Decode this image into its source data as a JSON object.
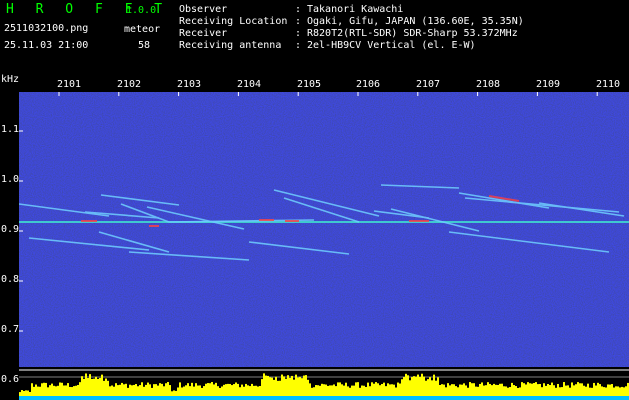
{
  "header": {
    "app_title": "H R O F F T",
    "app_version": "1.0.0",
    "file_name": "2511032100.png",
    "meteor_label": "meteor",
    "timestamp": "25.11.03 21:00",
    "meteor_count": "58"
  },
  "info": [
    {
      "key": "Observer",
      "value": "Takanori Kawachi"
    },
    {
      "key": "Receiving Location",
      "value": "Ogaki, Gifu, JAPAN (136.60E, 35.35N)"
    },
    {
      "key": "Receiver",
      "value": "R820T2(RTL-SDR) SDR-Sharp 53.372MHz"
    },
    {
      "key": "Receiving antenna",
      "value": "2el-HB9CV Vertical (el. E-W)"
    }
  ],
  "separator": ":",
  "axis": {
    "unit": "kHz",
    "y_ticks": [
      "1.1",
      "1.0",
      "0.9",
      "0.8",
      "0.7",
      "0.6"
    ],
    "x_ticks": [
      "2101",
      "2102",
      "2103",
      "2104",
      "2105",
      "2106",
      "2107",
      "2108",
      "2109",
      "2110"
    ]
  },
  "colors": {
    "background": "#000000",
    "noise": "#1a1aa8",
    "carrier": "#40e0d0",
    "trail": "#70d0ff",
    "hot": "#ff4040",
    "activity": "#ffff00",
    "title": "#00ff00"
  }
}
